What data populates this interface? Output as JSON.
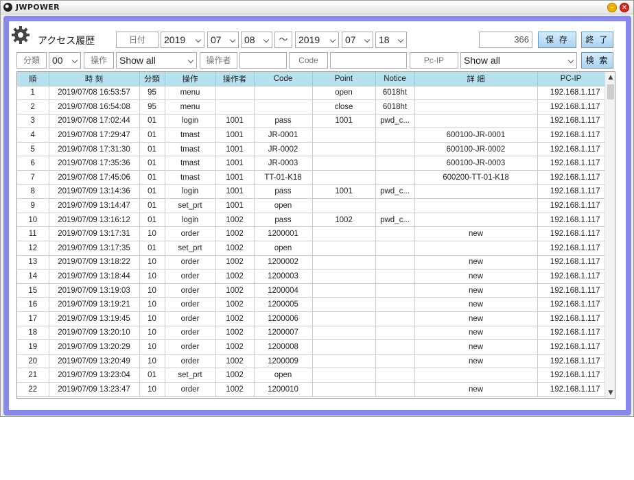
{
  "window": {
    "title": "JWPOWER",
    "min_symbol": "–",
    "close_symbol": "✕"
  },
  "header": {
    "title": "アクセス履歴",
    "date_label": "日付",
    "from_year": "2019",
    "from_month": "07",
    "from_day": "08",
    "tilde": "～",
    "to_year": "2019",
    "to_month": "07",
    "to_day": "18",
    "count": "366",
    "save_label": "保 存",
    "exit_label": "終 了"
  },
  "filters": {
    "category_label": "分類",
    "category_value": "00",
    "operation_label": "操作",
    "operation_value": "Show all",
    "operator_label": "操作者",
    "operator_value": "",
    "code_label": "Code",
    "code_value": "",
    "pcip_label": "Pc-IP",
    "pcip_value": "Show all",
    "search_label": "検 索"
  },
  "table": {
    "columns": [
      "順",
      "時 刻",
      "分類",
      "操作",
      "操作者",
      "Code",
      "Point",
      "Notice",
      "詳 細",
      "PC-IP"
    ],
    "rows": [
      [
        "1",
        "2019/07/08 16:53:57",
        "95",
        "menu",
        "",
        "",
        "open",
        "6018ht",
        "",
        "192.168.1.117"
      ],
      [
        "2",
        "2019/07/08 16:54:08",
        "95",
        "menu",
        "",
        "",
        "close",
        "6018ht",
        "",
        "192.168.1.117"
      ],
      [
        "3",
        "2019/07/08 17:02:44",
        "01",
        "login",
        "1001",
        "pass",
        "1001",
        "pwd_c...",
        "",
        "192.168.1.117"
      ],
      [
        "4",
        "2019/07/08 17:29:47",
        "01",
        "tmast",
        "1001",
        "JR-0001",
        "",
        "",
        "600100-JR-0001",
        "192.168.1.117"
      ],
      [
        "5",
        "2019/07/08 17:31:30",
        "01",
        "tmast",
        "1001",
        "JR-0002",
        "",
        "",
        "600100-JR-0002",
        "192.168.1.117"
      ],
      [
        "6",
        "2019/07/08 17:35:36",
        "01",
        "tmast",
        "1001",
        "JR-0003",
        "",
        "",
        "600100-JR-0003",
        "192.168.1.117"
      ],
      [
        "7",
        "2019/07/08 17:45:06",
        "01",
        "tmast",
        "1001",
        "TT-01-K18",
        "",
        "",
        "600200-TT-01-K18",
        "192.168.1.117"
      ],
      [
        "8",
        "2019/07/09 13:14:36",
        "01",
        "login",
        "1001",
        "pass",
        "1001",
        "pwd_c...",
        "",
        "192.168.1.117"
      ],
      [
        "9",
        "2019/07/09 13:14:47",
        "01",
        "set_prt",
        "1001",
        "open",
        "",
        "",
        "",
        "192.168.1.117"
      ],
      [
        "10",
        "2019/07/09 13:16:12",
        "01",
        "login",
        "1002",
        "pass",
        "1002",
        "pwd_c...",
        "",
        "192.168.1.117"
      ],
      [
        "11",
        "2019/07/09 13:17:31",
        "10",
        "order",
        "1002",
        "1200001",
        "",
        "",
        "new",
        "192.168.1.117"
      ],
      [
        "12",
        "2019/07/09 13:17:35",
        "01",
        "set_prt",
        "1002",
        "open",
        "",
        "",
        "",
        "192.168.1.117"
      ],
      [
        "13",
        "2019/07/09 13:18:22",
        "10",
        "order",
        "1002",
        "1200002",
        "",
        "",
        "new",
        "192.168.1.117"
      ],
      [
        "14",
        "2019/07/09 13:18:44",
        "10",
        "order",
        "1002",
        "1200003",
        "",
        "",
        "new",
        "192.168.1.117"
      ],
      [
        "15",
        "2019/07/09 13:19:03",
        "10",
        "order",
        "1002",
        "1200004",
        "",
        "",
        "new",
        "192.168.1.117"
      ],
      [
        "16",
        "2019/07/09 13:19:21",
        "10",
        "order",
        "1002",
        "1200005",
        "",
        "",
        "new",
        "192.168.1.117"
      ],
      [
        "17",
        "2019/07/09 13:19:45",
        "10",
        "order",
        "1002",
        "1200006",
        "",
        "",
        "new",
        "192.168.1.117"
      ],
      [
        "18",
        "2019/07/09 13:20:10",
        "10",
        "order",
        "1002",
        "1200007",
        "",
        "",
        "new",
        "192.168.1.117"
      ],
      [
        "19",
        "2019/07/09 13:20:29",
        "10",
        "order",
        "1002",
        "1200008",
        "",
        "",
        "new",
        "192.168.1.117"
      ],
      [
        "20",
        "2019/07/09 13:20:49",
        "10",
        "order",
        "1002",
        "1200009",
        "",
        "",
        "new",
        "192.168.1.117"
      ],
      [
        "21",
        "2019/07/09 13:23:04",
        "01",
        "set_prt",
        "1002",
        "open",
        "",
        "",
        "",
        "192.168.1.117"
      ],
      [
        "22",
        "2019/07/09 13:23:47",
        "10",
        "order",
        "1002",
        "1200010",
        "",
        "",
        "new",
        "192.168.1.117"
      ]
    ]
  },
  "scrollbar": {
    "up_symbol": "▲",
    "down_symbol": "▼"
  },
  "colors": {
    "frame": "#8888ee",
    "header_row": "#b7e1ef",
    "button": "#a9d3f2"
  }
}
